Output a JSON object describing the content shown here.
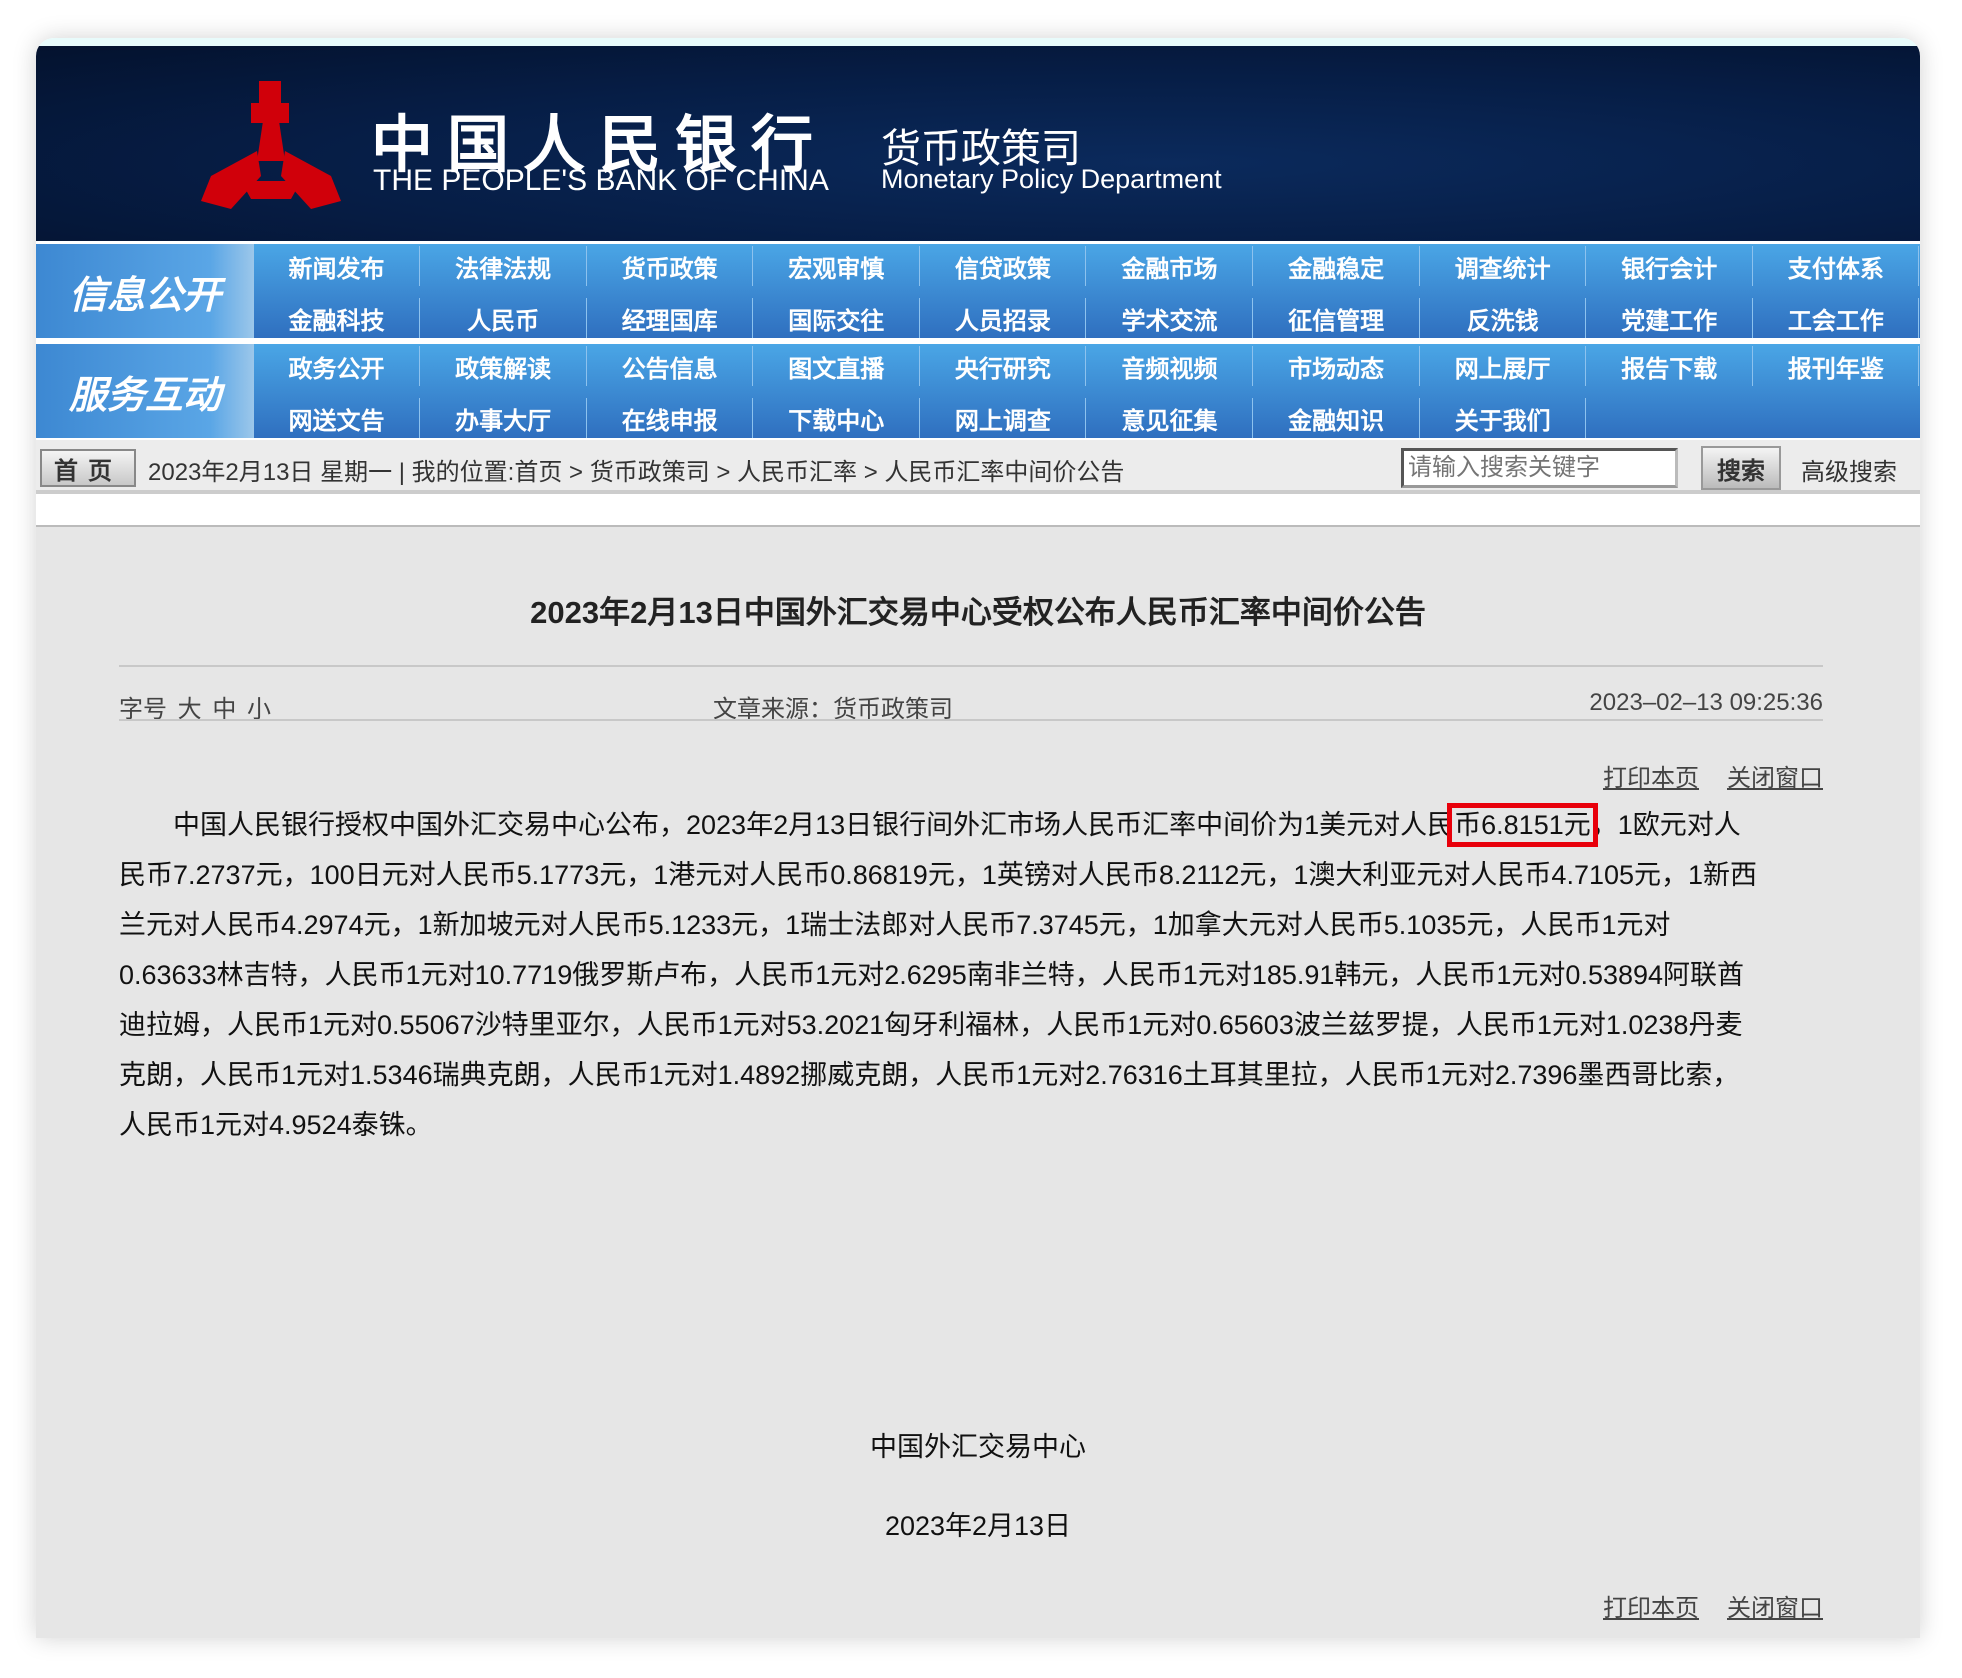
{
  "header": {
    "bank_cn": "中国人民银行",
    "bank_en": "THE PEOPLE'S BANK OF CHINA",
    "dept_cn": "货币政策司",
    "dept_en": "Monetary Policy Department"
  },
  "nav": {
    "group1": {
      "label": "信息公开",
      "row1": [
        "新闻发布",
        "法律法规",
        "货币政策",
        "宏观审慎",
        "信贷政策",
        "金融市场",
        "金融稳定",
        "调查统计",
        "银行会计",
        "支付体系"
      ],
      "row2": [
        "金融科技",
        "人民币",
        "经理国库",
        "国际交往",
        "人员招录",
        "学术交流",
        "征信管理",
        "反洗钱",
        "党建工作",
        "工会工作"
      ]
    },
    "group2": {
      "label": "服务互动",
      "row1": [
        "政务公开",
        "政策解读",
        "公告信息",
        "图文直播",
        "央行研究",
        "音频视频",
        "市场动态",
        "网上展厅",
        "报告下载",
        "报刊年鉴"
      ],
      "row2": [
        "网送文告",
        "办事大厅",
        "在线申报",
        "下载中心",
        "网上调查",
        "意见征集",
        "金融知识",
        "关于我们"
      ]
    }
  },
  "breadcrumb": {
    "home": "首页",
    "text": "2023年2月13日 星期一 | 我的位置:首页 > 货币政策司 > 人民币汇率 > 人民币汇率中间价公告",
    "search_placeholder": "请输入搜索关键字",
    "search_button": "搜索",
    "advanced": "高级搜索"
  },
  "article": {
    "title": "2023年2月13日中国外汇交易中心受权公布人民币汇率中间价公告",
    "font_label": "字号",
    "font_large": "大",
    "font_medium": "中",
    "font_small": "小",
    "source": "文章来源：货币政策司",
    "datetime": "2023–02–13 09:25:36",
    "print": "打印本页",
    "close": "关闭窗口",
    "line1_pre": "　　中国人民银行授权中国外汇交易中心公布，2023年2月13日银行间外汇市场人民币汇率中间价为1美元对人民",
    "line1_hl": "币6.8151元",
    "line1_post": "，1欧元对人",
    "lines": [
      "民币7.2737元，100日元对人民币5.1773元，1港元对人民币0.86819元，1英镑对人民币8.2112元，1澳大利亚元对人民币4.7105元，1新西",
      "兰元对人民币4.2974元，1新加坡元对人民币5.1233元，1瑞士法郎对人民币7.3745元，1加拿大元对人民币5.1035元，人民币1元对",
      "0.63633林吉特，人民币1元对10.7719俄罗斯卢布，人民币1元对2.6295南非兰特，人民币1元对185.91韩元，人民币1元对0.53894阿联酋",
      "迪拉姆，人民币1元对0.55067沙特里亚尔，人民币1元对53.2021匈牙利福林，人民币1元对0.65603波兰兹罗提，人民币1元对1.0238丹麦",
      "克朗，人民币1元对1.5346瑞典克朗，人民币1元对1.4892挪威克朗，人民币1元对2.76316土耳其里拉，人民币1元对2.7396墨西哥比索，",
      "人民币1元对4.9524泰铢。"
    ],
    "signature": "中国外汇交易中心",
    "sign_date": "2023年2月13日"
  },
  "colors": {
    "highlight": "#e8000b"
  }
}
